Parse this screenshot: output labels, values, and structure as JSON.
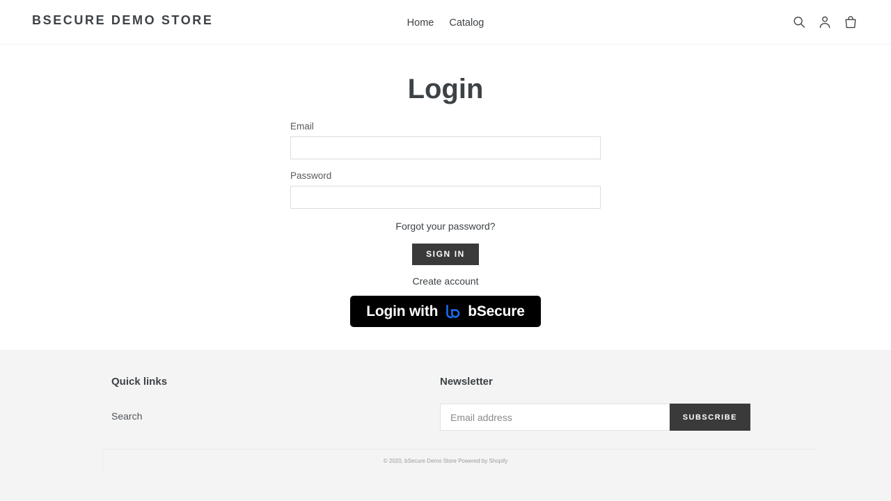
{
  "header": {
    "brand": "BSECURE DEMO STORE",
    "nav": [
      {
        "label": "Home",
        "name": "nav-link-home"
      },
      {
        "label": "Catalog",
        "name": "nav-link-catalog"
      }
    ],
    "icons": {
      "search": "search-icon",
      "account": "account-icon",
      "cart": "cart-icon"
    }
  },
  "main": {
    "title": "Login",
    "email": {
      "label": "Email",
      "value": "",
      "placeholder": ""
    },
    "password": {
      "label": "Password",
      "value": "",
      "placeholder": ""
    },
    "forgot_link": "Forgot your password?",
    "signin_button": "SIGN IN",
    "create_account_link": "Create account",
    "bsecure": {
      "prefix": "Login with",
      "brand": "bSecure",
      "logo_icon": "bsecure-logo-icon",
      "background_color": "#000000",
      "logo_color": "#1a6ef5"
    }
  },
  "footer": {
    "quick_links": {
      "heading": "Quick links",
      "items": [
        {
          "label": "Search",
          "name": "footer-link-search"
        }
      ]
    },
    "newsletter": {
      "heading": "Newsletter",
      "input_value": "",
      "input_placeholder": "Email address",
      "button_label": "SUBSCRIBE"
    },
    "copyright": "© 2020, bSecure Demo Store Powered by Shopify"
  },
  "colors": {
    "text": "#3d4246",
    "button_dark": "#3a3a3a",
    "footer_bg": "#f4f4f4",
    "accent_blue": "#1a6ef5"
  }
}
